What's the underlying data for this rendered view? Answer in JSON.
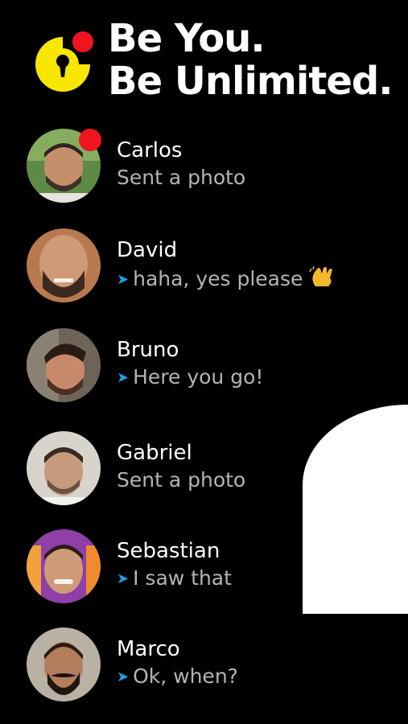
{
  "header": {
    "tagline_line1": "Be You.",
    "tagline_line2": "Be Unlimited."
  },
  "colors": {
    "background": "#000000",
    "logo_yellow": "#f7e600",
    "notification_red": "#f0141f",
    "sent_arrow_blue": "#1ea0e6",
    "preview_gray": "#b4b4b4"
  },
  "conversations": [
    {
      "name": "Carlos",
      "preview": "Sent a photo",
      "sent_by_me": false,
      "unread": true,
      "emoji": ""
    },
    {
      "name": "David",
      "preview": "haha, yes please",
      "sent_by_me": true,
      "unread": false,
      "emoji": "waving-hand-icon"
    },
    {
      "name": "Bruno",
      "preview": "Here you go!",
      "sent_by_me": true,
      "unread": false,
      "emoji": ""
    },
    {
      "name": "Gabriel",
      "preview": "Sent a photo",
      "sent_by_me": false,
      "unread": false,
      "emoji": ""
    },
    {
      "name": "Sebastian",
      "preview": "I saw that",
      "sent_by_me": true,
      "unread": false,
      "emoji": ""
    },
    {
      "name": "Marco",
      "preview": "Ok, when?",
      "sent_by_me": true,
      "unread": false,
      "emoji": ""
    }
  ]
}
